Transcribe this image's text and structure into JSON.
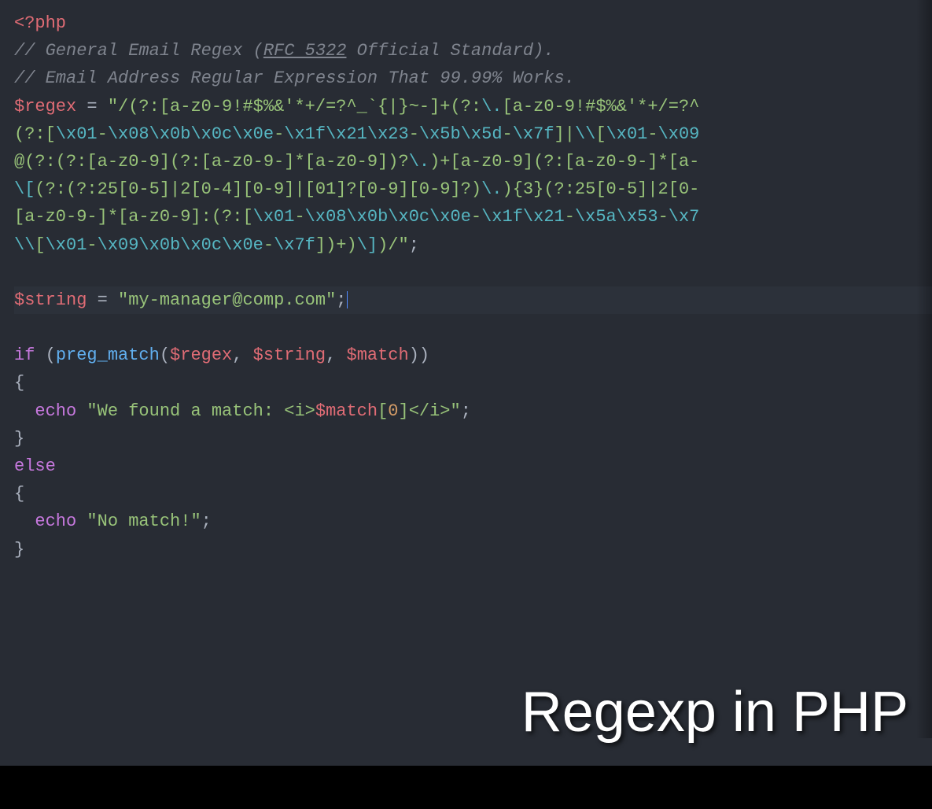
{
  "overlay_title": "Regexp in PHP",
  "lines": {
    "l1_phptag": "<?php",
    "l2_comment_pre": "// General Email Regex (",
    "l2_comment_u": "RFC 5322",
    "l2_comment_post": " Official Standard).",
    "l3_comment": "// Email Address Regular Expression That 99.99% Works.",
    "l4_var": "$regex",
    "l4_eq": " = ",
    "l4_q": "\"",
    "l4_str_a": "/(?:[a-z0-9!#$%&'*+/=?^_`{|}~-]+(?:",
    "l4_esc1": "\\.",
    "l4_str_b": "[a-z0-9!#$%&'*+/=?^",
    "l5_a": "(?:[",
    "l5_e1": "\\x01",
    "l5_d1": "-",
    "l5_e2": "\\x08\\x0b\\x0c\\x0e",
    "l5_d2": "-",
    "l5_e3": "\\x1f\\x21\\x23",
    "l5_d3": "-",
    "l5_e4": "\\x5b\\x5d",
    "l5_d4": "-",
    "l5_e5": "\\x7f",
    "l5_b": "]|",
    "l5_e6": "\\\\",
    "l5_c": "[",
    "l5_e7": "\\x01",
    "l5_d5": "-",
    "l5_e8": "\\x09",
    "l6_a": "@(?:(?:[a-z0-9](?:[a-z0-9-]*[a-z0-9])?",
    "l6_e1": "\\.",
    "l6_b": ")+[a-z0-9](?:[a-z0-9-]*[a-",
    "l7_e1": "\\[",
    "l7_a": "(?:(?:25[0-5]|2[0-4][0-9]|[01]?[0-9][0-9]?)",
    "l7_e2": "\\.",
    "l7_b": "){3}(?:25[0-5]|2[0-",
    "l8_a": "[a-z0-9-]*[a-z0-9]:(?:[",
    "l8_e1": "\\x01",
    "l8_d1": "-",
    "l8_e2": "\\x08\\x0b\\x0c\\x0e",
    "l8_d2": "-",
    "l8_e3": "\\x1f\\x21",
    "l8_d3": "-",
    "l8_e4": "\\x5a\\x53",
    "l8_d4": "-",
    "l8_e5": "\\x7",
    "l9_e1": "\\\\",
    "l9_a": "[",
    "l9_e2": "\\x01",
    "l9_d1": "-",
    "l9_e3": "\\x09\\x0b\\x0c\\x0e",
    "l9_d2": "-",
    "l9_e4": "\\x7f",
    "l9_b": "])+)",
    "l9_e5": "\\]",
    "l9_c": ")/",
    "l9_q": "\"",
    "l9_semi": ";",
    "l11_var": "$string",
    "l11_eq": " = ",
    "l11_q": "\"",
    "l11_str": "my-manager@comp.com",
    "l11_q2": "\"",
    "l11_semi": ";",
    "l13_if": "if",
    "l13_sp": " (",
    "l13_fn": "preg_match",
    "l13_p1": "(",
    "l13_v1": "$regex",
    "l13_c1": ", ",
    "l13_v2": "$string",
    "l13_c2": ", ",
    "l13_v3": "$match",
    "l13_p2": "))",
    "l14_brace": "{",
    "l15_indent": "  ",
    "l15_echo": "echo",
    "l15_sp": " ",
    "l15_q": "\"",
    "l15_str_a": "We found a match: <i>",
    "l15_var": "$match",
    "l15_idx_o": "[",
    "l15_idx_n": "0",
    "l15_idx_c": "]",
    "l15_str_b": "</i>",
    "l15_q2": "\"",
    "l15_semi": ";",
    "l16_brace": "}",
    "l17_else": "else",
    "l18_brace": "{",
    "l19_indent": "  ",
    "l19_echo": "echo",
    "l19_sp": " ",
    "l19_q": "\"",
    "l19_str": "No match!",
    "l19_q2": "\"",
    "l19_semi": ";",
    "l20_brace": "}"
  }
}
